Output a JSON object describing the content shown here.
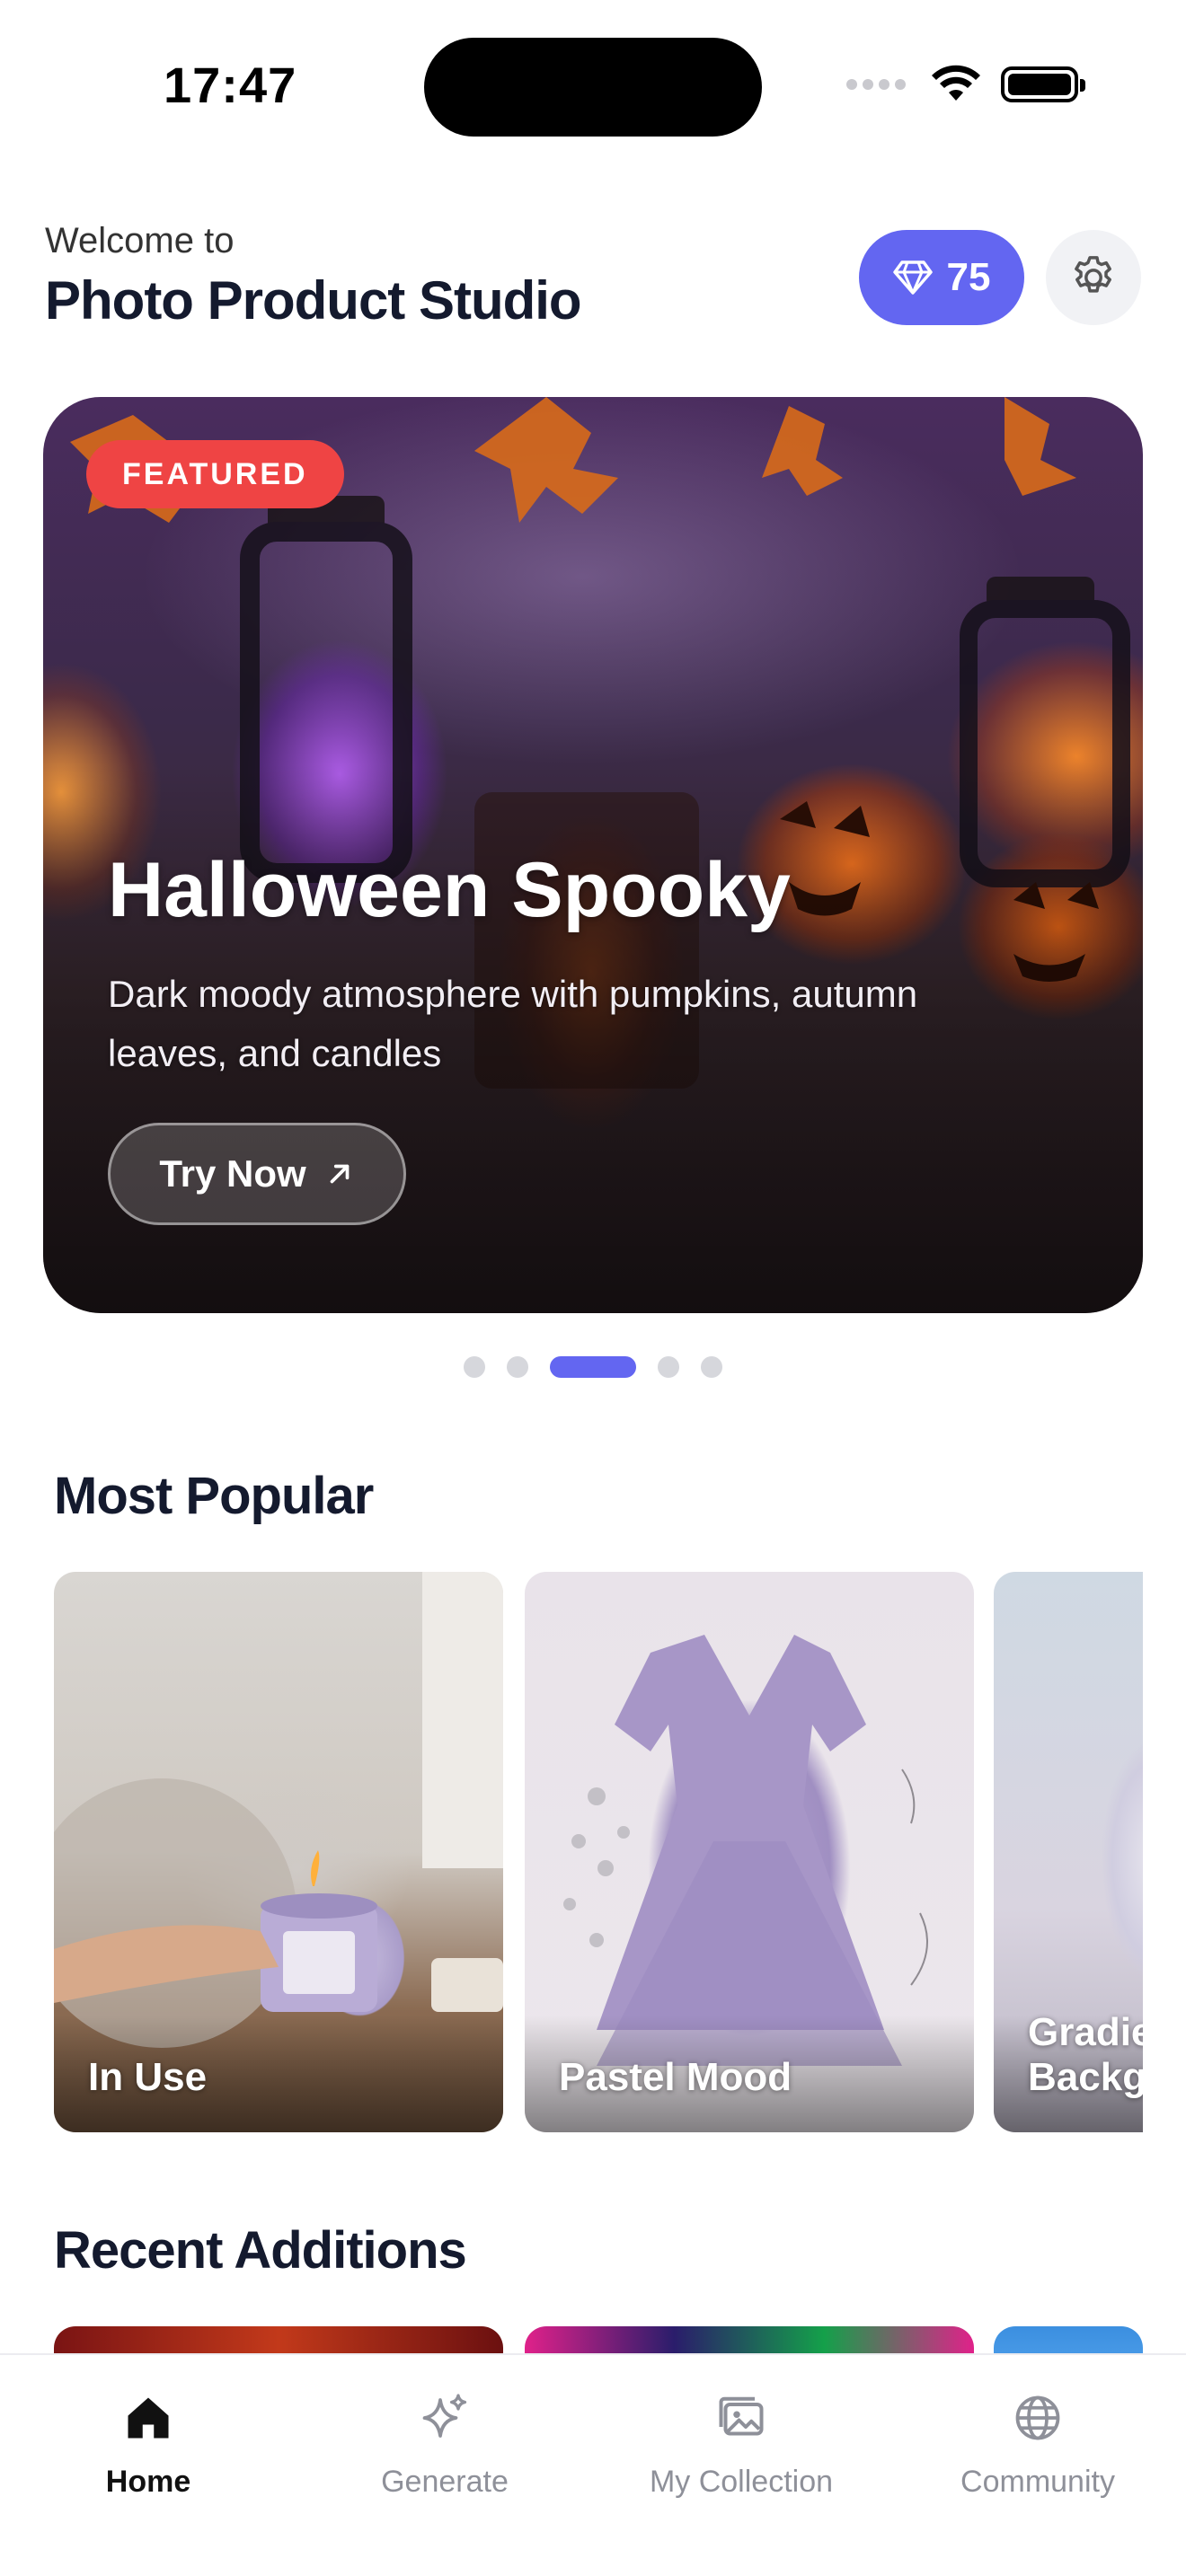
{
  "status_bar": {
    "time": "17:47"
  },
  "header": {
    "welcome": "Welcome to",
    "title": "Photo Product Studio",
    "credits": "75"
  },
  "hero": {
    "badge": "FEATURED",
    "title": "Halloween Spooky",
    "subtitle": "Dark moody atmosphere with pumpkins, autumn leaves, and candles",
    "button_label": "Try Now",
    "page_count": 5,
    "active_page": 3
  },
  "most_popular": {
    "title": "Most Popular",
    "cards": [
      {
        "label": "In Use"
      },
      {
        "label": "Pastel Mood"
      },
      {
        "label": "Gradient Background"
      }
    ]
  },
  "recent_additions": {
    "title": "Recent Additions"
  },
  "tabs": [
    {
      "label": "Home",
      "icon": "home-icon",
      "active": true
    },
    {
      "label": "Generate",
      "icon": "sparkle-icon",
      "active": false
    },
    {
      "label": "My Collection",
      "icon": "gallery-icon",
      "active": false
    },
    {
      "label": "Community",
      "icon": "globe-icon",
      "active": false
    }
  ],
  "colors": {
    "accent": "#6366f1",
    "badge": "#ef4444",
    "text": "#141a2e",
    "inactive_tab": "#8e9099"
  }
}
